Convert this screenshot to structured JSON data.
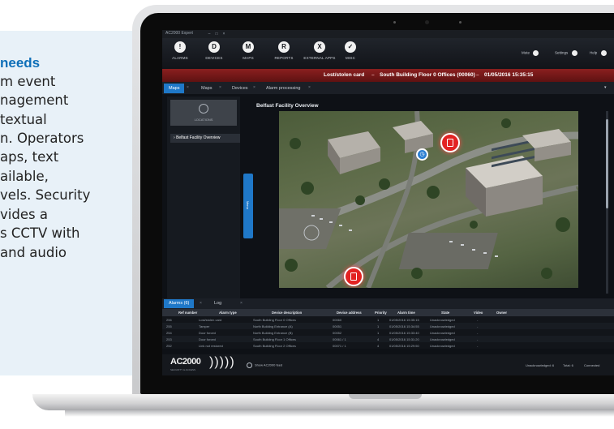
{
  "panel": {
    "heading": "needs",
    "lines": [
      "m event",
      "nagement",
      "textual",
      "n. Operators",
      "aps, text",
      "ailable,",
      "vels. Security",
      "vides a",
      "s CCTV with",
      "and audio"
    ]
  },
  "app": {
    "window_title": "AC2000 Expert",
    "toolbar": [
      {
        "label": "ALARMS",
        "icon": "bell-icon",
        "glyph": "!"
      },
      {
        "label": "DEVICES",
        "icon": "device-icon",
        "glyph": "D"
      },
      {
        "label": "MAPS",
        "icon": "map-pin-icon",
        "glyph": "M"
      },
      {
        "label": "REPORTS",
        "icon": "report-icon",
        "glyph": "R"
      },
      {
        "label": "EXTERNAL APPS",
        "icon": "apps-icon",
        "glyph": "X"
      },
      {
        "label": "MISC",
        "icon": "misc-icon",
        "glyph": "✓"
      }
    ],
    "toolbar_right": {
      "user": "Mute",
      "settings": "Settings",
      "help": "Help"
    },
    "alert": {
      "title": "Lost/stolen card",
      "location": "South Building Floor 0 Offices (00060)",
      "datetime": "01/05/2016 15:35:15"
    },
    "tabs": [
      "Maps",
      "Maps",
      "Devices",
      "Alarm processing"
    ],
    "sidebar": {
      "thumb_label": "LOCATIONS",
      "tree_item": "Belfast Facility Overview",
      "handle_label": "Menu"
    },
    "map_title": "Belfast Facility Overview",
    "alarm_tabs": [
      "Alarms (6)",
      "Log"
    ],
    "table": {
      "columns": [
        "Ref number",
        "Alarm type",
        "Device description",
        "Device address",
        "Priority",
        "Alarm time",
        "State",
        "Video",
        "Owner"
      ],
      "rows": [
        [
          "256",
          "Lost/stolen card",
          "South Building Floor 0 Offices",
          "00060",
          "1",
          "01/05/2016 15:35:15",
          "Unacknowledged",
          "-",
          ""
        ],
        [
          "255",
          "Tamper",
          "North Building Entrance (A)",
          "00051",
          "1",
          "01/05/2016 15:34:55",
          "Unacknowledged",
          "-",
          ""
        ],
        [
          "254",
          "Door forced",
          "North Building Entrance (B)",
          "00052",
          "1",
          "01/05/2016 15:33:40",
          "Unacknowledged",
          "-",
          ""
        ],
        [
          "253",
          "Door forced",
          "South Building Floor 1 Offices",
          "00061 / 1",
          "4",
          "01/05/2016 15:31:20",
          "Unacknowledged",
          "-",
          ""
        ],
        [
          "252",
          "Link not restored",
          "South Building Floor 2 Offices",
          "00071 / 1",
          "4",
          "01/05/2016 15:29:50",
          "Unacknowledged",
          "-",
          ""
        ]
      ]
    },
    "footer": {
      "brand": "AC2000",
      "brand_sub": "SECURITY & ACCESS",
      "center": "Show AC2000 feed",
      "right": [
        "Unacknowledged: 6",
        "Total: 6",
        "Connected"
      ]
    }
  },
  "colors": {
    "accent": "#1f78c8",
    "alert_red": "#8a1f1f",
    "marker_red": "#e32222",
    "heading_blue": "#0e6fb8"
  }
}
